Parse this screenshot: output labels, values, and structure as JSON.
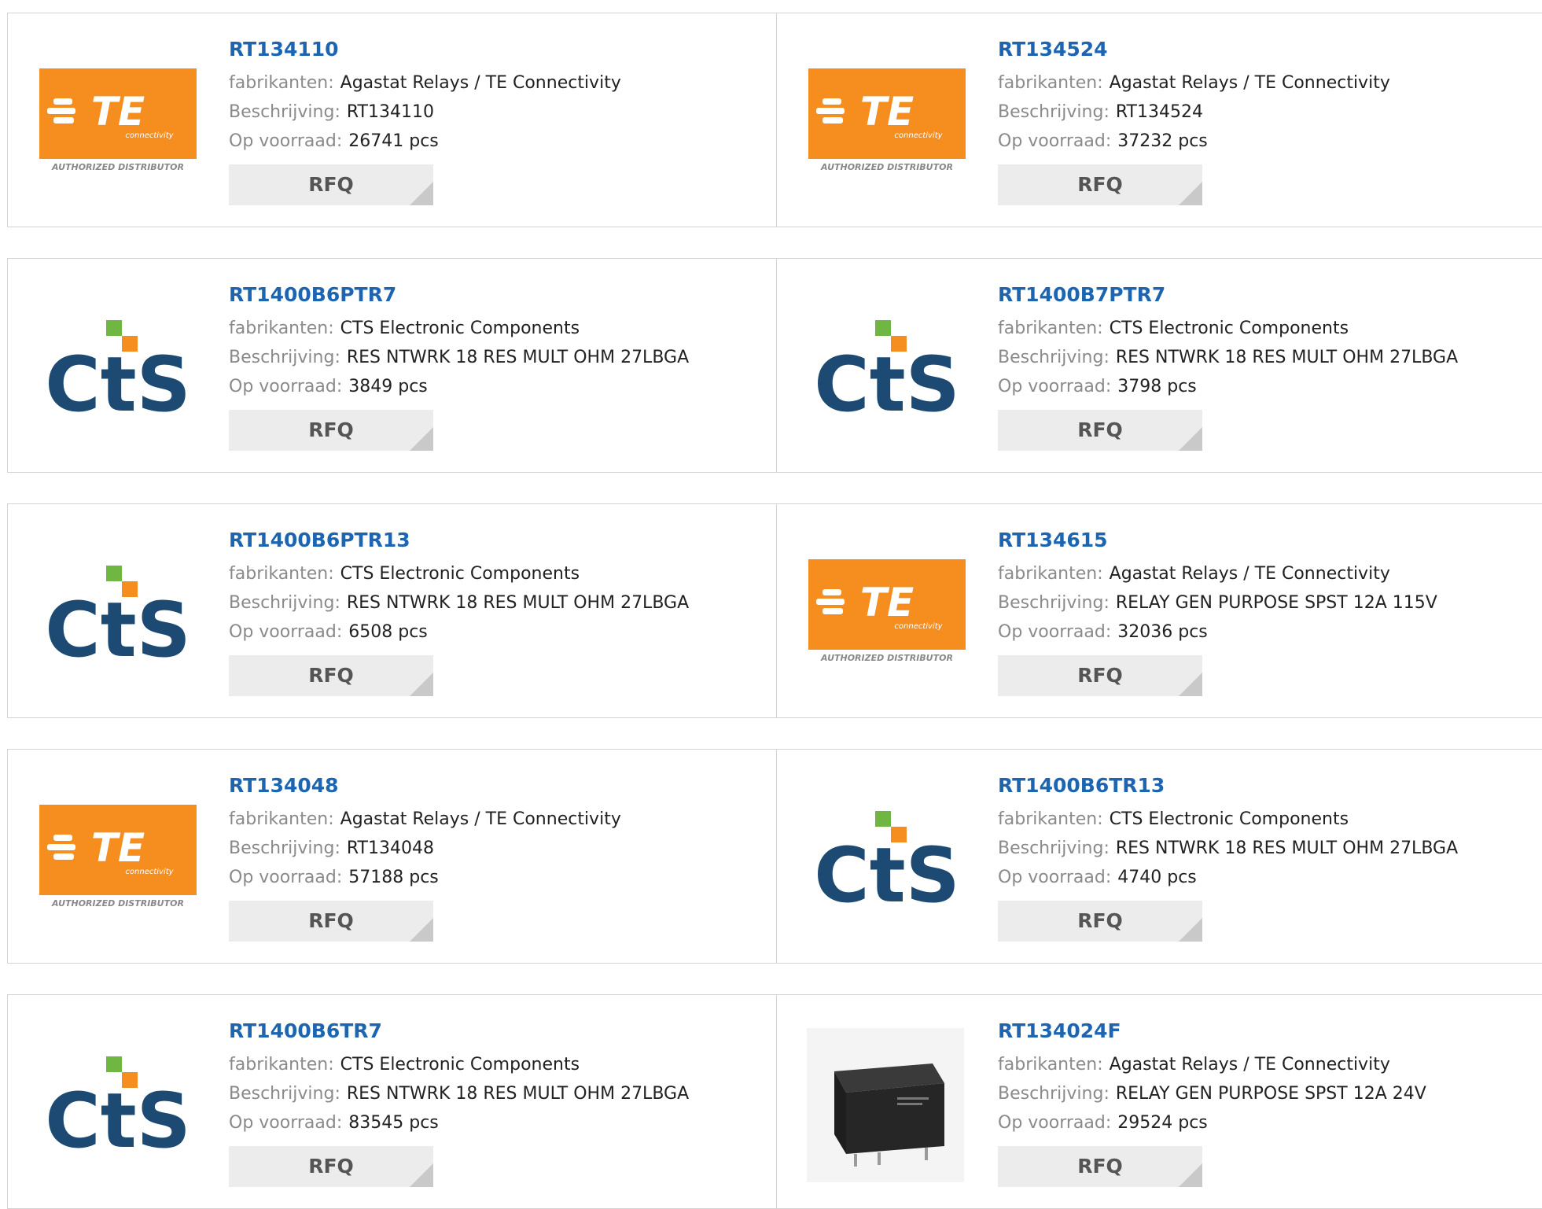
{
  "labels": {
    "manufacturer": "fabrikanten:",
    "description": "Beschrijving:",
    "stock": "Op voorraad:",
    "rfq": "RFQ"
  },
  "logos": {
    "te_text": "TE",
    "te_sub": "connectivity",
    "te_tagline": "AUTHORIZED DISTRIBUTOR",
    "cts_text": "CtS"
  },
  "colors": {
    "part_link": "#1d65b1",
    "te_orange": "#f68d1f",
    "cts_navy": "#1c4a73",
    "cts_orange": "#f68d1f",
    "cts_green": "#6fb742"
  },
  "products": [
    {
      "part": "RT134110",
      "logo": "te",
      "manufacturer": "Agastat Relays / TE Connectivity",
      "description": "RT134110",
      "stock": "26741 pcs"
    },
    {
      "part": "RT134524",
      "logo": "te",
      "manufacturer": "Agastat Relays / TE Connectivity",
      "description": "RT134524",
      "stock": "37232 pcs"
    },
    {
      "part": "RT1400B6PTR7",
      "logo": "cts",
      "manufacturer": "CTS Electronic Components",
      "description": "RES NTWRK 18 RES MULT OHM 27LBGA",
      "stock": "3849 pcs"
    },
    {
      "part": "RT1400B7PTR7",
      "logo": "cts",
      "manufacturer": "CTS Electronic Components",
      "description": "RES NTWRK 18 RES MULT OHM 27LBGA",
      "stock": "3798 pcs"
    },
    {
      "part": "RT1400B6PTR13",
      "logo": "cts",
      "manufacturer": "CTS Electronic Components",
      "description": "RES NTWRK 18 RES MULT OHM 27LBGA",
      "stock": "6508 pcs"
    },
    {
      "part": "RT134615",
      "logo": "te",
      "manufacturer": "Agastat Relays / TE Connectivity",
      "description": "RELAY GEN PURPOSE SPST 12A 115V",
      "stock": "32036 pcs"
    },
    {
      "part": "RT134048",
      "logo": "te",
      "manufacturer": "Agastat Relays / TE Connectivity",
      "description": "RT134048",
      "stock": "57188 pcs"
    },
    {
      "part": "RT1400B6TR13",
      "logo": "cts",
      "manufacturer": "CTS Electronic Components",
      "description": "RES NTWRK 18 RES MULT OHM 27LBGA",
      "stock": "4740 pcs"
    },
    {
      "part": "RT1400B6TR7",
      "logo": "cts",
      "manufacturer": "CTS Electronic Components",
      "description": "RES NTWRK 18 RES MULT OHM 27LBGA",
      "stock": "83545 pcs"
    },
    {
      "part": "RT134024F",
      "logo": "relay",
      "manufacturer": "Agastat Relays / TE Connectivity",
      "description": "RELAY GEN PURPOSE SPST 12A 24V",
      "stock": "29524 pcs"
    }
  ]
}
